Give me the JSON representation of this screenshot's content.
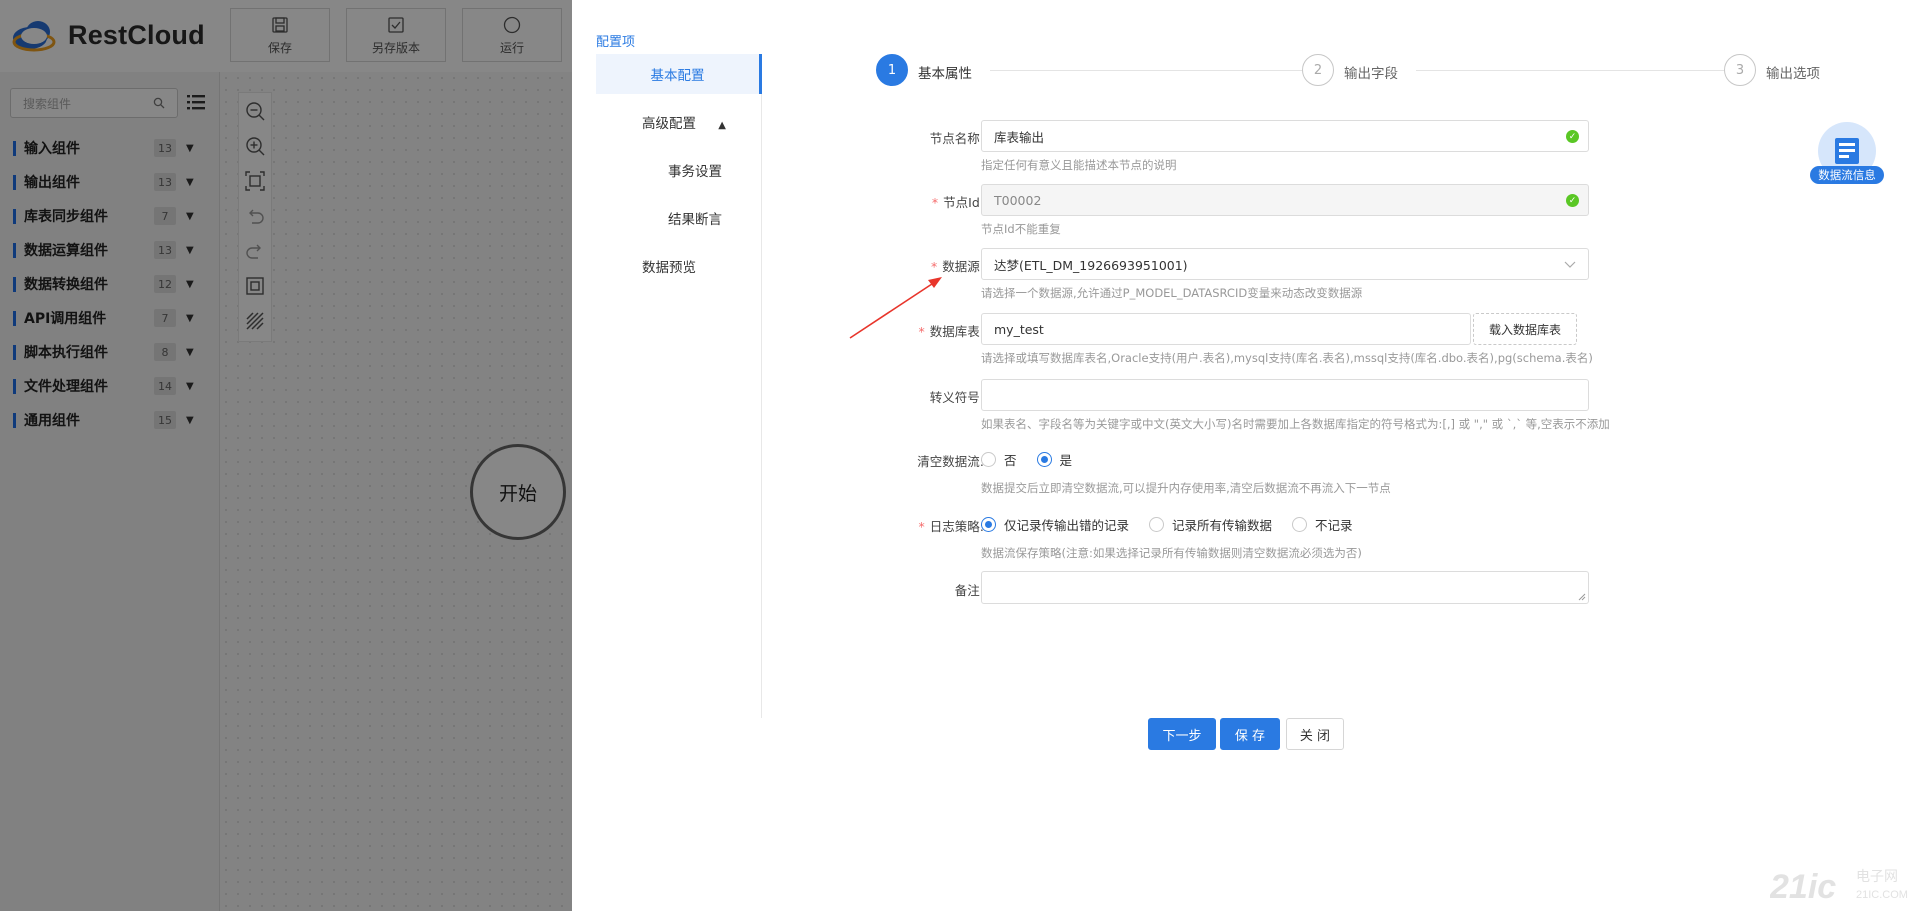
{
  "app": {
    "logo_text": "RestCloud",
    "toolbar": [
      {
        "label": "保存",
        "icon": "save-icon"
      },
      {
        "label": "另存版本",
        "icon": "save-version-icon"
      },
      {
        "label": "运行",
        "icon": "run-icon"
      }
    ],
    "search_placeholder": "搜索组件",
    "categories": [
      {
        "label": "输入组件",
        "count": "13"
      },
      {
        "label": "输出组件",
        "count": "13"
      },
      {
        "label": "库表同步组件",
        "count": "7"
      },
      {
        "label": "数据运算组件",
        "count": "13"
      },
      {
        "label": "数据转换组件",
        "count": "12"
      },
      {
        "label": "API调用组件",
        "count": "7"
      },
      {
        "label": "脚本执行组件",
        "count": "8"
      },
      {
        "label": "文件处理组件",
        "count": "14"
      },
      {
        "label": "通用组件",
        "count": "15"
      }
    ],
    "start_node": "开始"
  },
  "drawer": {
    "config_title": "配置项",
    "menu": {
      "basic": "基本配置",
      "advanced": "高级配置",
      "transaction": "事务设置",
      "assertion": "结果断言",
      "preview": "数据预览"
    },
    "steps": [
      {
        "num": "1",
        "label": "基本属性"
      },
      {
        "num": "2",
        "label": "输出字段"
      },
      {
        "num": "3",
        "label": "输出选项"
      }
    ],
    "form": {
      "node_name": {
        "label": "节点名称:",
        "value": "库表输出",
        "hint": "指定任何有意义且能描述本节点的说明"
      },
      "node_id": {
        "label": "节点Id:",
        "value": "T00002",
        "hint": "节点Id不能重复"
      },
      "datasource": {
        "label": "数据源:",
        "value": "达梦(ETL_DM_1926693951001)",
        "hint": "请选择一个数据源,允许通过P_MODEL_DATASRCID变量来动态改变数据源"
      },
      "table": {
        "label": "数据库表:",
        "value": "my_test",
        "load_button": "载入数据库表",
        "hint": "请选择或填写数据库表名,Oracle支持(用户.表名),mysql支持(库名.表名),mssql支持(库名.dbo.表名),pg(schema.表名)"
      },
      "escape": {
        "label": "转义符号:",
        "value": "",
        "hint": "如果表名、字段名等为关键字或中文(英文大小写)名时需要加上各数据库指定的符号格式为:[,] 或 \",\" 或 `,` 等,空表示不添加"
      },
      "clear_stream": {
        "label": "清空数据流:",
        "options": [
          "否",
          "是"
        ],
        "hint": "数据提交后立即清空数据流,可以提升内存使用率,清空后数据流不再流入下一节点"
      },
      "log_policy": {
        "label": "日志策略:",
        "options": [
          "仅记录传输出错的记录",
          "记录所有传输数据",
          "不记录"
        ],
        "hint": "数据流保存策略(注意:如果选择记录所有传输数据则清空数据流必须选为否)"
      },
      "remark": {
        "label": "备注:",
        "value": ""
      }
    },
    "buttons": {
      "next": "下一步",
      "save": "保 存",
      "close": "关 闭"
    },
    "flow_info": "数据流信息"
  },
  "watermark": {
    "text": "21ic",
    "sub1": "电子网",
    "sub2": "21IC.COM"
  },
  "colors": {
    "accent": "#2a7ae2",
    "required": "#f56c6c",
    "success": "#5ac725"
  }
}
